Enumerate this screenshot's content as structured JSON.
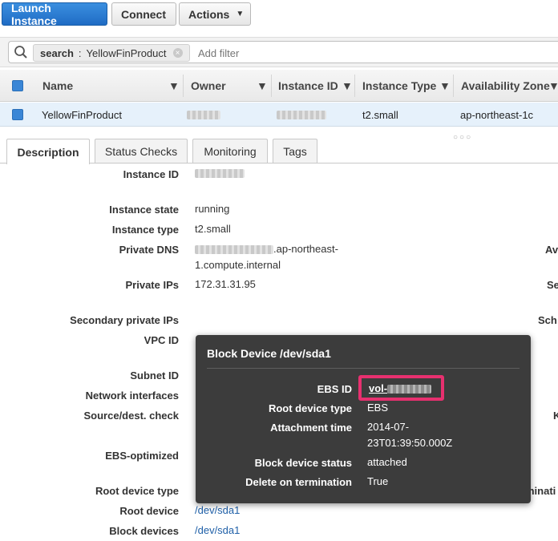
{
  "toolbar": {
    "launch_label": "Launch Instance",
    "connect_label": "Connect",
    "actions_label": "Actions"
  },
  "search": {
    "chip_key": "search",
    "chip_sep": ":",
    "chip_value": "YellowFinProduct",
    "placeholder": "Add filter"
  },
  "table": {
    "columns": [
      "Name",
      "Owner",
      "Instance ID",
      "Instance Type",
      "Availability Zone"
    ],
    "row": {
      "name": "YellowFinProduct",
      "instance_type": "t2.small",
      "availability_zone": "ap-northeast-1c"
    }
  },
  "tabs": [
    "Description",
    "Status Checks",
    "Monitoring",
    "Tags"
  ],
  "details": {
    "instance_id_label": "Instance ID",
    "instance_state_label": "Instance state",
    "instance_state_value": "running",
    "instance_type_label": "Instance type",
    "instance_type_value": "t2.small",
    "private_dns_label": "Private DNS",
    "private_dns_value_1": ".ap-northeast-",
    "private_dns_value_2": "1.compute.internal",
    "private_ips_label": "Private IPs",
    "private_ips_value": "172.31.31.95",
    "secondary_ips_label": "Secondary private IPs",
    "vpc_id_label": "VPC ID",
    "subnet_id_label": "Subnet ID",
    "network_interfaces_label": "Network interfaces",
    "source_dest_label": "Source/dest. check",
    "ebs_optimized_label": "EBS-optimized",
    "root_device_type_label": "Root device type",
    "root_device_label": "Root device",
    "root_device_value": "/dev/sda1",
    "block_devices_label": "Block devices",
    "block_devices_value": "/dev/sda1"
  },
  "right_column_fragments": {
    "av": "Av",
    "se": "Se",
    "sch": "Sch",
    "k": "K",
    "minati": "minati"
  },
  "tooltip": {
    "title": "Block Device /dev/sda1",
    "ebs_id_label": "EBS ID",
    "ebs_id_value": "vol-",
    "root_device_type_label": "Root device type",
    "root_device_type_value": "EBS",
    "attachment_time_label": "Attachment time",
    "attachment_time_value_1": "2014-07-",
    "attachment_time_value_2": "23T01:39:50.000Z",
    "block_device_status_label": "Block device status",
    "block_device_status_value": "attached",
    "delete_on_termination_label": "Delete on termination",
    "delete_on_termination_value": "True"
  },
  "colors": {
    "primary_button": "#1f6cc4",
    "selected_row": "#e6f1fb",
    "tooltip_bg": "#3c3c3c",
    "highlight": "#e7306f",
    "link": "#2060a8"
  }
}
